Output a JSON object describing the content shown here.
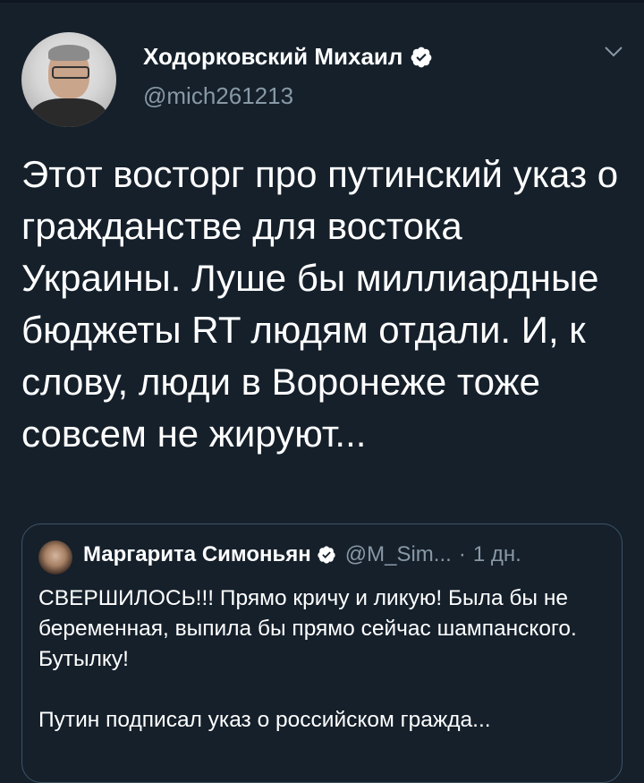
{
  "tweet": {
    "author_name": "Ходорковский Михаил",
    "author_handle": "@mich261213",
    "text": "Этот восторг про путинский указ о гражданстве для востока Украины. Луше бы миллиардные бюджеты RT людям отдали. И, к слову, люди в Воронеже тоже совсем не жируют...",
    "icons": [
      "avatar",
      "verified-badge-icon",
      "chevron-down-icon"
    ]
  },
  "quoted": {
    "author_name": "Маргарита Симоньян",
    "author_handle": "@M_Sim...",
    "separator": "·",
    "time": "1 дн.",
    "line1": "СВЕРШИЛОСЬ!!! Прямо кричу и ликую! Была бы не беременная, выпила бы прямо сейчас шампанского. Бутылку!",
    "line2": "Путин подписал указ о российском гражда..."
  },
  "colors": {
    "background": "#15202b",
    "text": "#ffffff",
    "secondary": "#8899a6",
    "border": "#3d5466",
    "verified": "#ffffff"
  }
}
